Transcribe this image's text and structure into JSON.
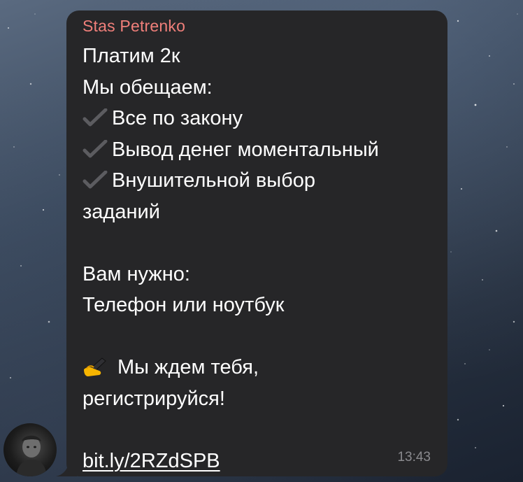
{
  "message": {
    "sender": "Stas Petrenko",
    "lines": [
      "Платим 2к",
      "Мы обещаем:",
      "Все по закону",
      "Вывод денег моментальный",
      "Внушительной выбор",
      "заданий",
      "",
      "Вам нужно:",
      "Телефон или ноутбук",
      "",
      "Мы ждем тебя,",
      "регистрируйся!",
      ""
    ],
    "link": "bit.ly/2RZdSPB",
    "time": "13:43"
  },
  "icons": {
    "check": "check-mark-icon",
    "writing": "writing-hand-icon",
    "avatar": "sender-avatar"
  },
  "colors": {
    "bubble": "#262628",
    "sender_name": "#f07f7a",
    "text": "#ffffff",
    "time": "#8a8a8e"
  }
}
